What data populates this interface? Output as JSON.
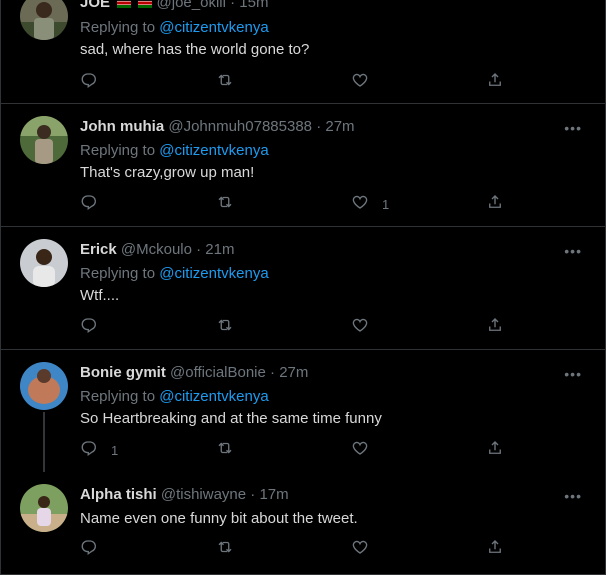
{
  "tweets": [
    {
      "name": "JOE",
      "handle": "@joe_okili",
      "time": "· 15m",
      "replying_prefix": "Replying to ",
      "mention": "@citizentvkenya",
      "text": "sad, where has the world gone to?",
      "reply_count": "",
      "like_count": ""
    },
    {
      "name": "John muhia",
      "handle": "@Johnmuh07885388",
      "time": "· 27m",
      "replying_prefix": "Replying to ",
      "mention": "@citizentvkenya",
      "text": "That's crazy,grow up man!",
      "reply_count": "",
      "like_count": "1"
    },
    {
      "name": "Erick",
      "handle": "@Mckoulo",
      "time": "· 21m",
      "replying_prefix": "Replying to ",
      "mention": "@citizentvkenya",
      "text": "Wtf....",
      "reply_count": "",
      "like_count": ""
    },
    {
      "name": "Bonie gymit",
      "handle": "@officialBonie",
      "time": "· 27m",
      "replying_prefix": "Replying to ",
      "mention": "@citizentvkenya",
      "text": "So Heartbreaking and at the same time funny",
      "reply_count": "1",
      "like_count": ""
    },
    {
      "name": "Alpha tishi",
      "handle": "@tishiwayne",
      "time": "· 17m",
      "replying_prefix": "",
      "mention": "",
      "text": "Name even one funny bit about the tweet.",
      "reply_count": "",
      "like_count": ""
    }
  ],
  "icons": {
    "reply": "reply-icon",
    "retweet": "retweet-icon",
    "like": "like-icon",
    "share": "share-icon",
    "more": "more-icon"
  },
  "more_glyph": "•••",
  "colors": {
    "background": "#000000",
    "text": "#d9d9d9",
    "secondary": "#6e767d",
    "link": "#1d9bf0",
    "border": "#2f3336"
  }
}
